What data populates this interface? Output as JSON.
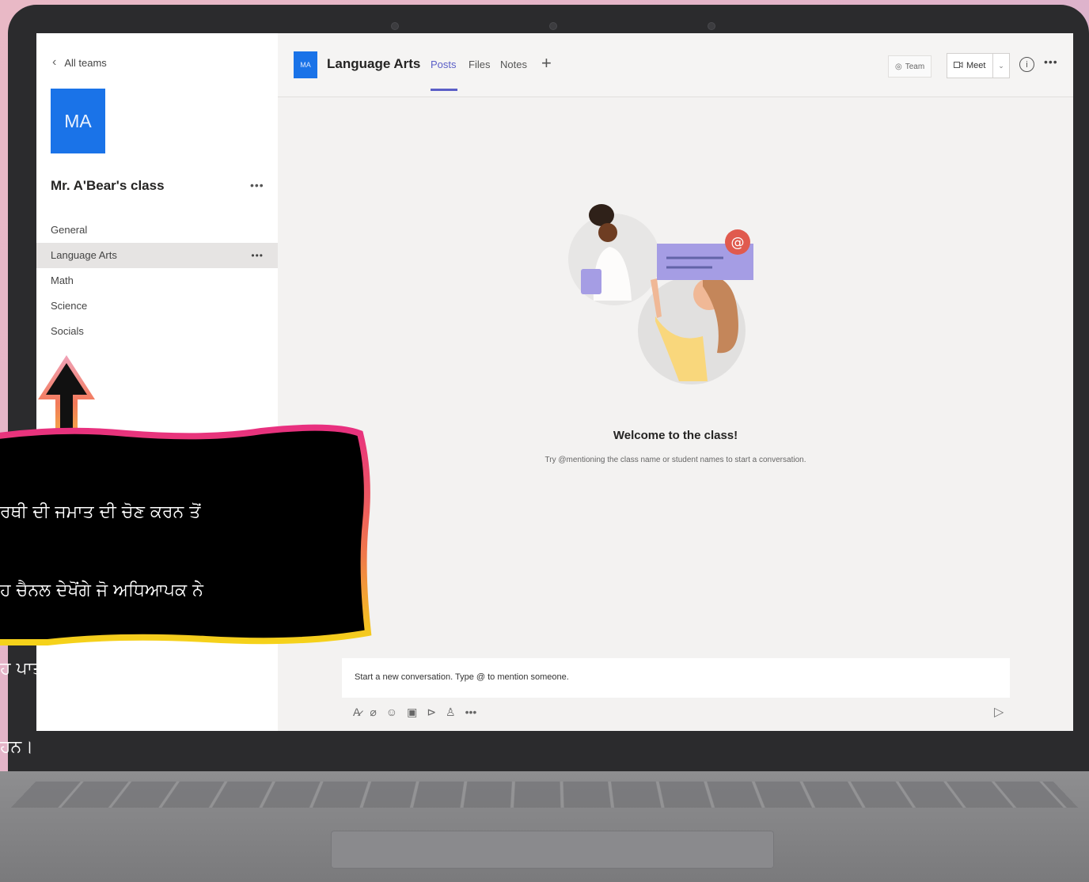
{
  "sidebar": {
    "back_label": "All teams",
    "team_initials": "MA",
    "team_name": "Mr. A'Bear's class",
    "team_more": "•••",
    "channels": [
      {
        "label": "General"
      },
      {
        "label": "Language Arts",
        "more": "•••"
      },
      {
        "label": "Math"
      },
      {
        "label": "Science"
      },
      {
        "label": "Socials"
      }
    ]
  },
  "header": {
    "channel_initials": "MA",
    "channel_title": "Language Arts",
    "tabs": [
      {
        "label": "Posts"
      },
      {
        "label": "Files"
      },
      {
        "label": "Notes"
      }
    ],
    "add_tab": "+",
    "team_button": "Team",
    "meet_button": "Meet",
    "more": "•••"
  },
  "main": {
    "welcome_title": "Welcome to the class!",
    "welcome_subtitle": "Try @mentioning the class name or student names to start a conversation."
  },
  "compose": {
    "placeholder": "Start a new conversation. Type @ to mention someone.",
    "tools": [
      "format-icon",
      "attach-icon",
      "emoji-icon",
      "sticker-icon",
      "meet-now-icon",
      "praise-icon",
      "more-icon"
    ],
    "more": "•••"
  },
  "callout": {
    "lines": [
      "ਰਥੀ ਦੀ ਜਮਾਤ ਦੀ ਚੋਣ ਕਰਨ ਤੋਂ",
      "ਹ ਚੈਨਲ ਦੇਖੋਂਗੇ ਜੋ ਅਧਿਆਪਕ ਨੇ",
      "ਹ ਪਾਤਰ, ਇਕਾਈਆਂ, ਜਾਂ ਹੋਰ",
      "ਹਨ।"
    ]
  },
  "colors": {
    "accent": "#5b5fc7",
    "team_avatar": "#1a73e8",
    "callout_border_pink": "#e8307f",
    "callout_border_yellow": "#f5d21a",
    "arrow_fill": "#111111"
  }
}
